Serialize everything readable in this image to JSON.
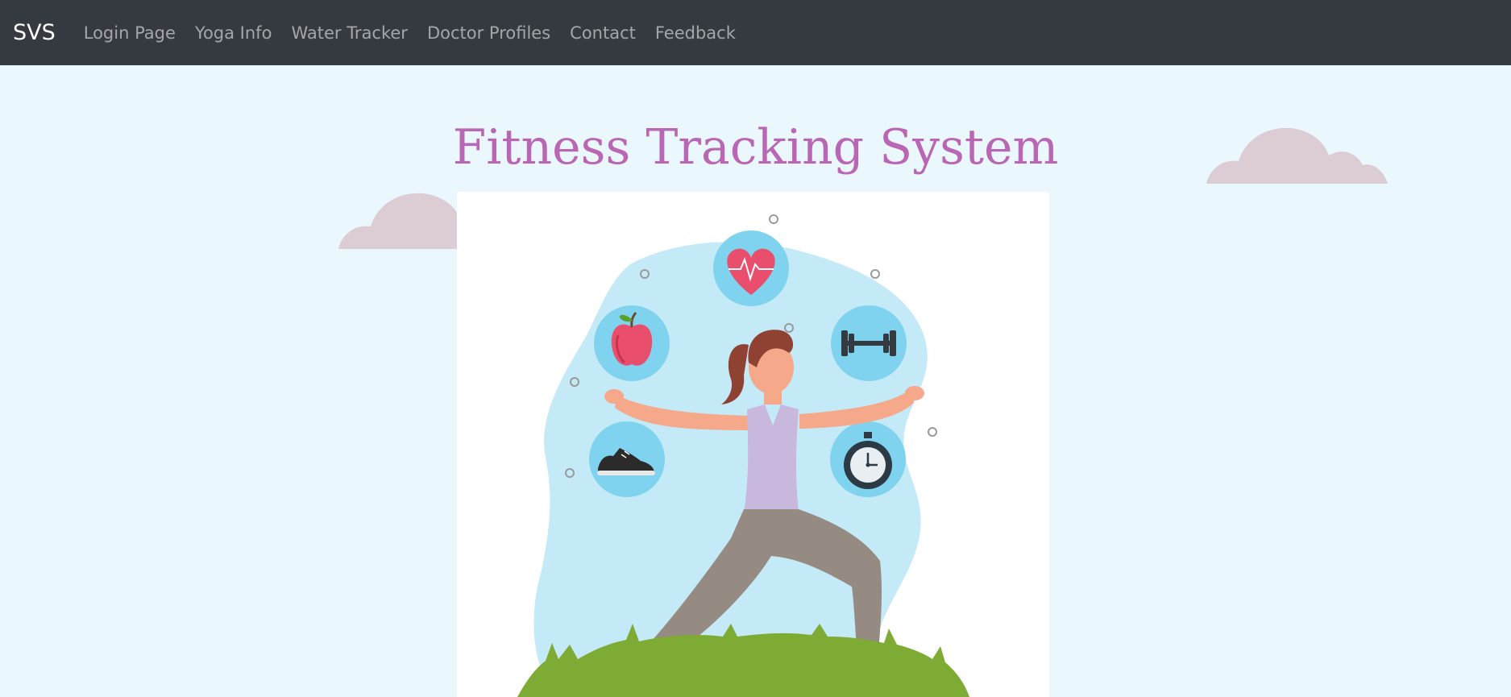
{
  "navbar": {
    "brand": "SVS",
    "links": [
      {
        "label": "Login Page"
      },
      {
        "label": "Yoga Info"
      },
      {
        "label": "Water Tracker"
      },
      {
        "label": "Doctor Profiles"
      },
      {
        "label": "Contact"
      },
      {
        "label": "Feedback"
      }
    ]
  },
  "hero": {
    "title": "Fitness Tracking System"
  },
  "colors": {
    "navbar_bg": "#343a40",
    "page_bg": "#eaf8fe",
    "title": "#b967b4",
    "cloud": "#dbcdd3",
    "blob": "#c4eaf8",
    "icon_circle": "#7fd3ee",
    "grass": "#7eab33"
  },
  "illustration": {
    "icons": [
      "heart-rate-icon",
      "apple-icon",
      "dumbbell-icon",
      "sneaker-icon",
      "stopwatch-icon"
    ]
  }
}
